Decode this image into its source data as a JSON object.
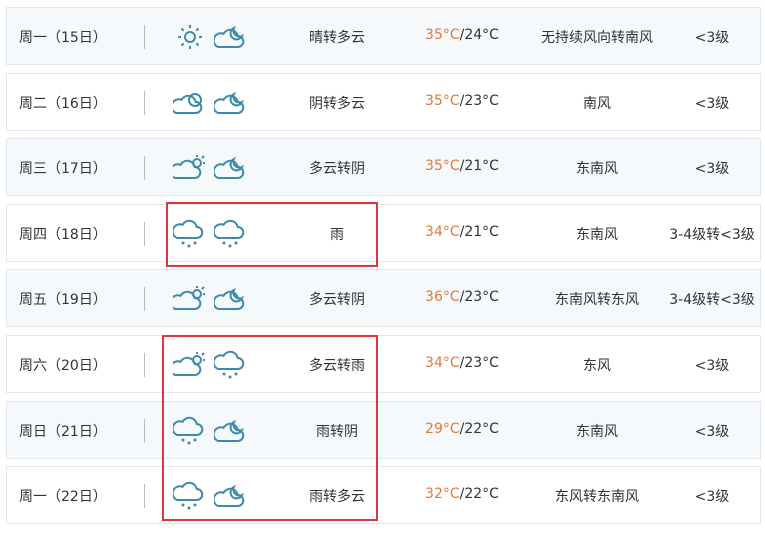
{
  "colors": {
    "high_temp": "#e07b3a",
    "icon": "#3f8aa8",
    "highlight_box": "#d9393b"
  },
  "rows": [
    {
      "day": "周一（15日）",
      "icons": [
        "sun-icon",
        "cloud-moon-icon"
      ],
      "weather": "晴转多云",
      "high": "35°C",
      "low": "/24°C",
      "wind": "无持续风向转南风",
      "level": "<3级"
    },
    {
      "day": "周二（16日）",
      "icons": [
        "overcast-icon",
        "cloud-moon-icon"
      ],
      "weather": "阴转多云",
      "high": "35°C",
      "low": "/23°C",
      "wind": "南风",
      "level": "<3级"
    },
    {
      "day": "周三（17日）",
      "icons": [
        "cloud-sun-icon",
        "cloud-moon-icon"
      ],
      "weather": "多云转阴",
      "high": "35°C",
      "low": "/21°C",
      "wind": "东南风",
      "level": "<3级"
    },
    {
      "day": "周四（18日）",
      "icons": [
        "rain-icon",
        "rain-icon"
      ],
      "weather": "雨",
      "high": "34°C",
      "low": "/21°C",
      "wind": "东南风",
      "level": "3-4级转<3级"
    },
    {
      "day": "周五（19日）",
      "icons": [
        "cloud-sun-icon",
        "cloud-moon-icon"
      ],
      "weather": "多云转阴",
      "high": "36°C",
      "low": "/23°C",
      "wind": "东南风转东风",
      "level": "3-4级转<3级"
    },
    {
      "day": "周六（20日）",
      "icons": [
        "cloud-sun-icon",
        "rain-icon"
      ],
      "weather": "多云转雨",
      "high": "34°C",
      "low": "/23°C",
      "wind": "东风",
      "level": "<3级"
    },
    {
      "day": "周日（21日）",
      "icons": [
        "rain-icon",
        "cloud-moon-icon"
      ],
      "weather": "雨转阴",
      "high": "29°C",
      "low": "/22°C",
      "wind": "东南风",
      "level": "<3级"
    },
    {
      "day": "周一（22日）",
      "icons": [
        "rain-icon",
        "cloud-moon-icon"
      ],
      "weather": "雨转多云",
      "high": "32°C",
      "low": "/22°C",
      "wind": "东风转东南风",
      "level": "<3级"
    }
  ]
}
